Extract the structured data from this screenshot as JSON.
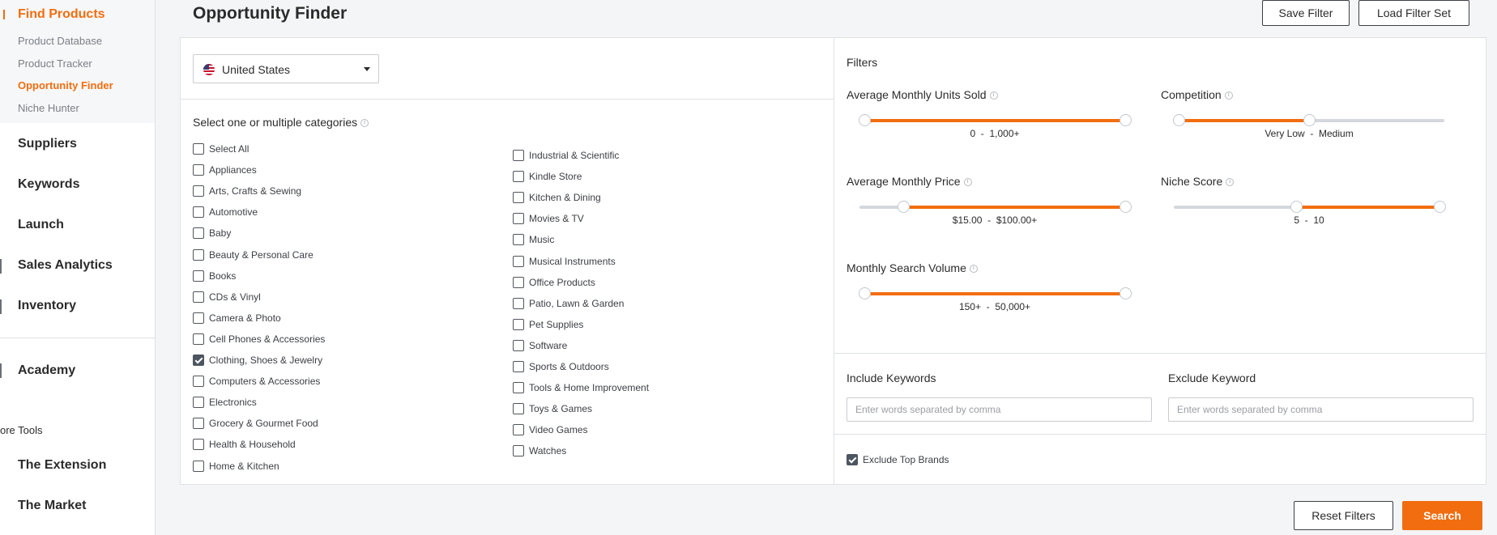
{
  "sidebar": {
    "find_products": "Find Products",
    "sub_items": [
      "Product Database",
      "Product Tracker",
      "Opportunity Finder",
      "Niche Hunter"
    ],
    "suppliers": "Suppliers",
    "keywords": "Keywords",
    "launch": "Launch",
    "sales_analytics": "Sales Analytics",
    "inventory": "Inventory",
    "academy": "Academy",
    "more_tools": "ore Tools",
    "the_extension": "The Extension",
    "the_market": "The Market"
  },
  "header": {
    "title": "Opportunity Finder",
    "save_filter": "Save Filter",
    "load_filter_set": "Load Filter Set"
  },
  "country": {
    "label": "United States"
  },
  "categories": {
    "heading": "Select one or multiple categories",
    "col1": [
      {
        "label": "Select All",
        "checked": false
      },
      {
        "label": "Appliances",
        "checked": false
      },
      {
        "label": "Arts, Crafts & Sewing",
        "checked": false
      },
      {
        "label": "Automotive",
        "checked": false
      },
      {
        "label": "Baby",
        "checked": false
      },
      {
        "label": "Beauty & Personal Care",
        "checked": false
      },
      {
        "label": "Books",
        "checked": false
      },
      {
        "label": "CDs & Vinyl",
        "checked": false
      },
      {
        "label": "Camera & Photo",
        "checked": false
      },
      {
        "label": "Cell Phones & Accessories",
        "checked": false
      },
      {
        "label": "Clothing, Shoes & Jewelry",
        "checked": true
      },
      {
        "label": "Computers & Accessories",
        "checked": false
      },
      {
        "label": "Electronics",
        "checked": false
      },
      {
        "label": "Grocery & Gourmet Food",
        "checked": false
      },
      {
        "label": "Health & Household",
        "checked": false
      },
      {
        "label": "Home & Kitchen",
        "checked": false
      }
    ],
    "col2": [
      {
        "label": "Industrial & Scientific",
        "checked": false
      },
      {
        "label": "Kindle Store",
        "checked": false
      },
      {
        "label": "Kitchen & Dining",
        "checked": false
      },
      {
        "label": "Movies & TV",
        "checked": false
      },
      {
        "label": "Music",
        "checked": false
      },
      {
        "label": "Musical Instruments",
        "checked": false
      },
      {
        "label": "Office Products",
        "checked": false
      },
      {
        "label": "Patio, Lawn & Garden",
        "checked": false
      },
      {
        "label": "Pet Supplies",
        "checked": false
      },
      {
        "label": "Software",
        "checked": false
      },
      {
        "label": "Sports & Outdoors",
        "checked": false
      },
      {
        "label": "Tools & Home Improvement",
        "checked": false
      },
      {
        "label": "Toys & Games",
        "checked": false
      },
      {
        "label": "Video Games",
        "checked": false
      },
      {
        "label": "Watches",
        "checked": false
      }
    ]
  },
  "filters": {
    "heading": "Filters",
    "units": {
      "title": "Average Monthly Units Sold",
      "range": "0  -  1,000+",
      "low": 0,
      "high": 1
    },
    "competition": {
      "title": "Competition",
      "range": "Very Low  -  Medium",
      "low": 0,
      "high": 0.5
    },
    "price": {
      "title": "Average Monthly Price",
      "range": "$15.00  -  $100.00+",
      "low": 0.15,
      "high": 1
    },
    "niche": {
      "title": "Niche Score",
      "range": "5  -  10",
      "low": 0.45,
      "high": 1
    },
    "search_volume": {
      "title": "Monthly Search Volume",
      "range": "150+  -  50,000+",
      "low": 0,
      "high": 1
    }
  },
  "keywords": {
    "include_label": "Include Keywords",
    "exclude_label": "Exclude Keyword",
    "include_placeholder": "Enter words separated by comma",
    "exclude_placeholder": "Enter words separated by comma"
  },
  "exclude_top_brands": {
    "label": "Exclude Top Brands",
    "checked": true
  },
  "actions": {
    "reset": "Reset Filters",
    "search": "Search"
  },
  "colors": {
    "accent": "#f26d0f",
    "text": "#2b2b2b",
    "checked": "#4d5660"
  }
}
